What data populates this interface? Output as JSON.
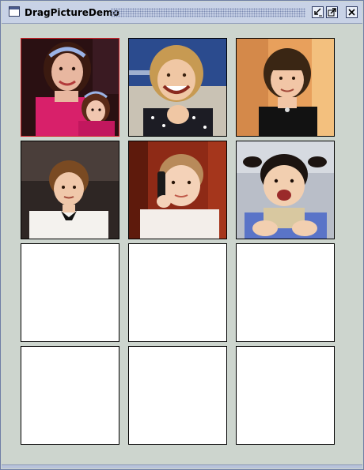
{
  "window": {
    "title": "DragPictureDemo",
    "icon": "java-window-icon",
    "controls": [
      "iconify-icon",
      "maximize-icon",
      "close-icon"
    ]
  },
  "grid": {
    "columns": 3,
    "rows": 4,
    "selected_index": 0,
    "cells": [
      {
        "picture": "girl-with-doll"
      },
      {
        "picture": "blonde-girl-smiling"
      },
      {
        "picture": "girl-with-bangs"
      },
      {
        "picture": "boy-in-white-suit"
      },
      {
        "picture": "toddler-with-phone"
      },
      {
        "picture": "baby-with-pigtails"
      },
      {
        "picture": "empty"
      },
      {
        "picture": "empty"
      },
      {
        "picture": "empty"
      },
      {
        "picture": "empty"
      },
      {
        "picture": "empty"
      },
      {
        "picture": "empty"
      }
    ]
  },
  "colors": {
    "background": "#cdd5ce",
    "titlebar": "#c8d2e6",
    "selection_border": "#d4232a",
    "cell_border": "#000000",
    "empty_cell": "#ffffff"
  }
}
